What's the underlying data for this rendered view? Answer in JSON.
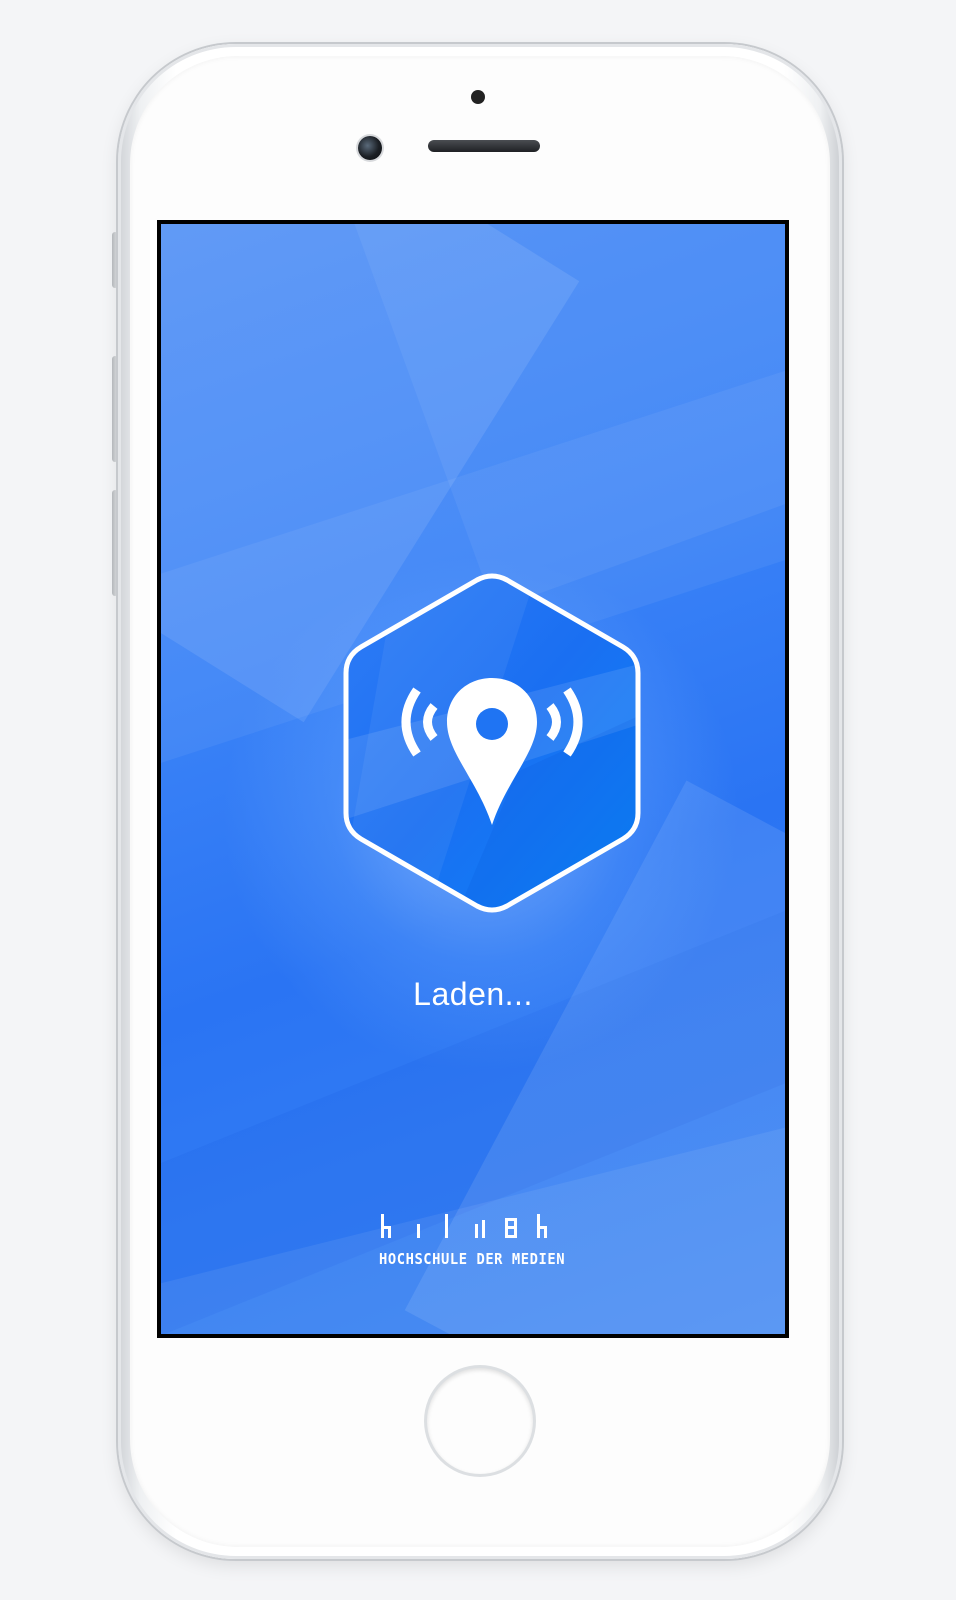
{
  "screen": {
    "background_color": "#3b83f7",
    "app_icon": {
      "icon": "location-pin-broadcast-icon",
      "shape": "hexagon"
    },
    "loading_label": "Laden...",
    "logo": {
      "icon": "hdm-logo-icon",
      "text": "HOCHSCHULE DER MEDIEN"
    }
  },
  "device": {
    "type": "phone",
    "frame_color": "#ffffff"
  }
}
